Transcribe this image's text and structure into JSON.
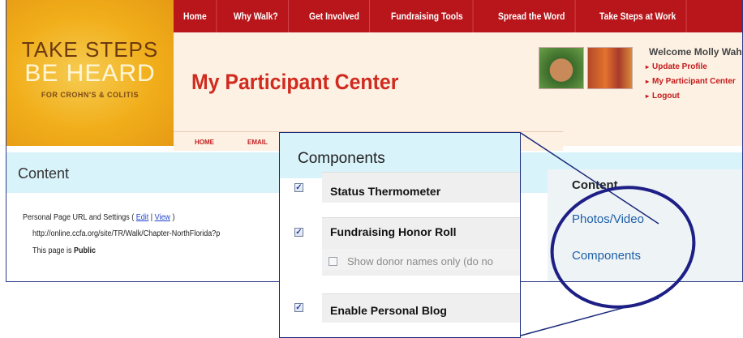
{
  "logo": {
    "line1": "TAKE STEPS",
    "line2": "BE HEARD",
    "line3": "FOR CROHN'S & COLITIS"
  },
  "top_nav": [
    {
      "label": "Home"
    },
    {
      "label": "Why Walk?"
    },
    {
      "label": "Get Involved"
    },
    {
      "label": "Fundraising Tools"
    },
    {
      "label": "Spread the Word"
    },
    {
      "label": "Take Steps at Work"
    }
  ],
  "header": {
    "title": "My Participant Center",
    "subnav_home": "HOME",
    "subnav_email": "EMAIL"
  },
  "welcome": {
    "greeting": "Welcome Molly Wahl",
    "links": [
      "Update Profile",
      "My Participant Center",
      "Logout"
    ]
  },
  "content": {
    "title": "Content",
    "url_settings_label": "Personal Page URL and Settings (",
    "edit_link": "Edit",
    "separator": " | ",
    "view_link": "View",
    "close_paren": " )",
    "page_url": "http://online.ccfa.org/site/TR/Walk/Chapter-NorthFlorida?p",
    "page_status_prefix": "This page is ",
    "page_status_value": "Public"
  },
  "side_panel": {
    "title": "Content",
    "links": [
      "Photos/Video",
      "Components"
    ]
  },
  "callout": {
    "title": "Components",
    "items": [
      {
        "label": "Status Thermometer",
        "checked": true
      },
      {
        "label": "Fundraising Honor Roll",
        "checked": true
      },
      {
        "label": "Enable Personal Blog",
        "checked": true
      }
    ],
    "sub_option": {
      "label": "Show donor names only (do no",
      "checked": false
    }
  },
  "colors": {
    "nav_red": "#b8161b",
    "title_red": "#d02b1e",
    "content_bar": "#d9f3fa",
    "link_blue": "#1d5ea8",
    "annotation_navy": "#1a2a7a"
  }
}
